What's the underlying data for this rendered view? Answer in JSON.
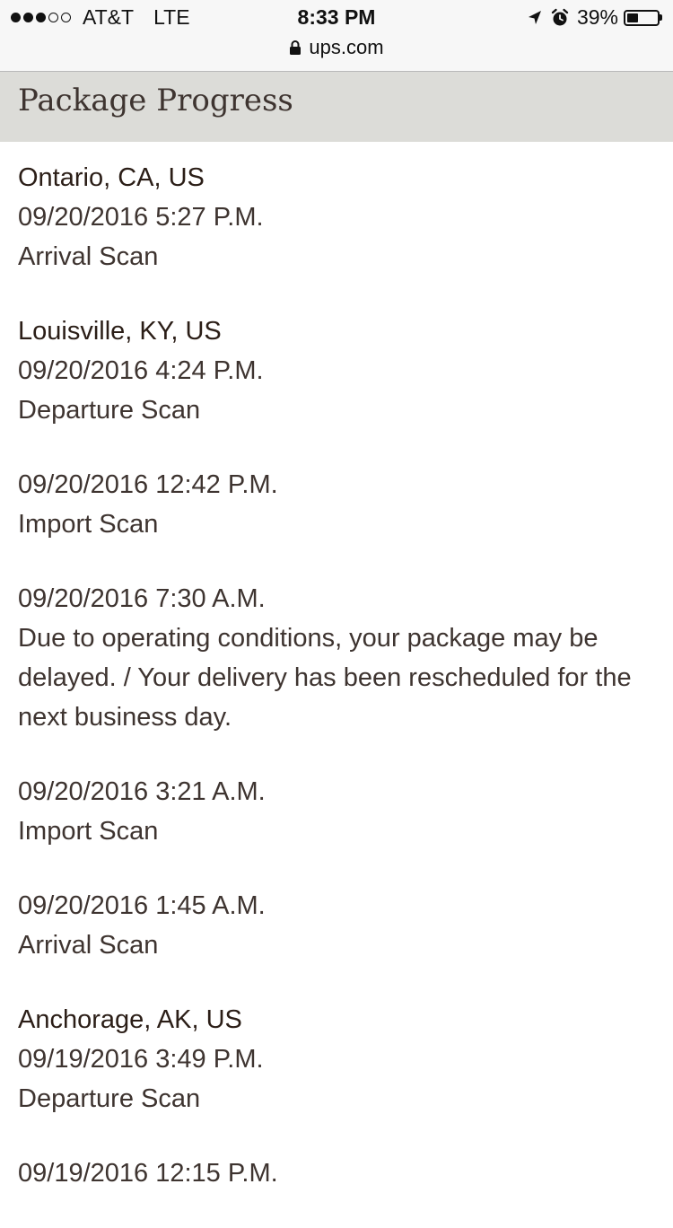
{
  "status_bar": {
    "carrier": "AT&T",
    "network": "LTE",
    "signal_bars_filled": 3,
    "signal_bars_total": 5,
    "time": "8:33 PM",
    "battery_percent": "39%",
    "battery_level": 0.39
  },
  "url_bar": {
    "domain": "ups.com"
  },
  "header": {
    "title": "Package Progress"
  },
  "events": [
    {
      "location": "Ontario, CA, US",
      "datetime": "09/20/2016 5:27 P.M.",
      "activity": "Arrival Scan"
    },
    {
      "location": "Louisville, KY, US",
      "datetime": "09/20/2016 4:24 P.M.",
      "activity": "Departure Scan"
    },
    {
      "location": "",
      "datetime": "09/20/2016 12:42 P.M.",
      "activity": "Import Scan"
    },
    {
      "location": "",
      "datetime": "09/20/2016 7:30 A.M.",
      "activity": "Due to operating conditions, your package may be delayed. / Your delivery has been rescheduled for the next business day."
    },
    {
      "location": "",
      "datetime": "09/20/2016 3:21 A.M.",
      "activity": "Import Scan"
    },
    {
      "location": "",
      "datetime": "09/20/2016 1:45 A.M.",
      "activity": "Arrival Scan"
    },
    {
      "location": "Anchorage, AK, US",
      "datetime": "09/19/2016 3:49 P.M.",
      "activity": "Departure Scan"
    },
    {
      "location": "",
      "datetime": "09/19/2016 12:15 P.M.",
      "activity": ""
    }
  ],
  "colors": {
    "header_bg": "#dcdcd8",
    "text": "#3e3430",
    "status_bg": "#f7f7f7"
  }
}
